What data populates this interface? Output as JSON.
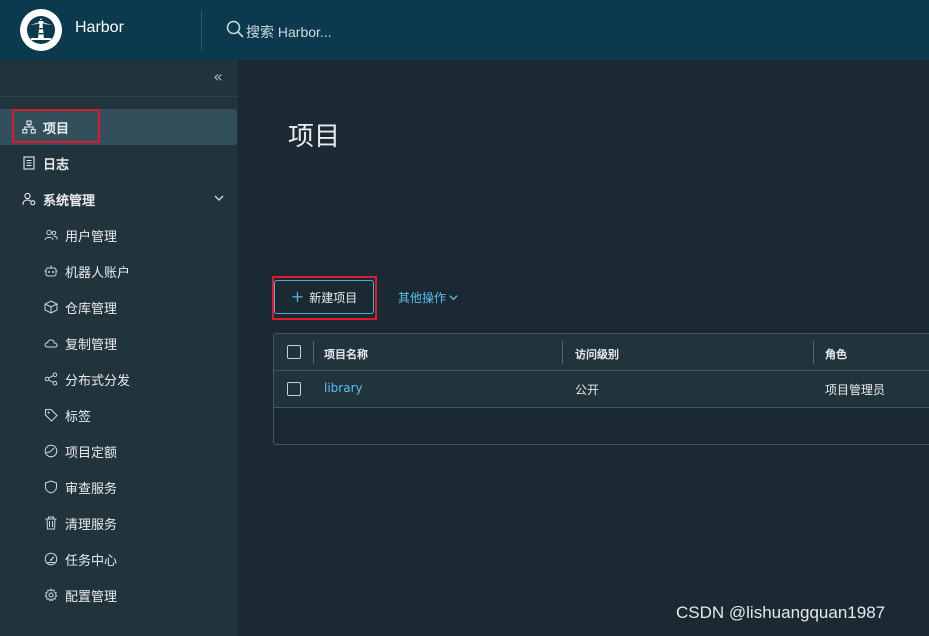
{
  "app": {
    "brand": "Harbor",
    "search_placeholder": "搜索 Harbor..."
  },
  "sidebar": {
    "collapse_label": "«",
    "items": [
      {
        "label": "项目",
        "icon": "projects-icon"
      },
      {
        "label": "日志",
        "icon": "log-icon"
      },
      {
        "label": "系统管理",
        "icon": "admin-icon"
      }
    ],
    "sub_items": [
      {
        "label": "用户管理",
        "icon": "users-icon"
      },
      {
        "label": "机器人账户",
        "icon": "robot-icon"
      },
      {
        "label": "仓库管理",
        "icon": "box-icon"
      },
      {
        "label": "复制管理",
        "icon": "cloud-icon"
      },
      {
        "label": "分布式分发",
        "icon": "share-icon"
      },
      {
        "label": "标签",
        "icon": "tag-icon"
      },
      {
        "label": "项目定额",
        "icon": "quota-icon"
      },
      {
        "label": "审查服务",
        "icon": "shield-icon"
      },
      {
        "label": "清理服务",
        "icon": "trash-icon"
      },
      {
        "label": "任务中心",
        "icon": "dashboard-icon"
      },
      {
        "label": "配置管理",
        "icon": "gear-icon"
      }
    ]
  },
  "main": {
    "title": "项目",
    "new_project_label": "新建项目",
    "more_actions_label": "其他操作",
    "table": {
      "headers": [
        "项目名称",
        "访问级别",
        "角色"
      ],
      "rows": [
        {
          "name": "library",
          "access": "公开",
          "role": "项目管理员"
        }
      ]
    }
  },
  "watermark": "CSDN @lishuangquan1987",
  "colors": {
    "topbar": "#0b3a4f",
    "sidebar": "#21333b",
    "background": "#1b2a32",
    "accent": "#49afd9",
    "link": "#57c1f0",
    "highlight": "#e0192b"
  }
}
